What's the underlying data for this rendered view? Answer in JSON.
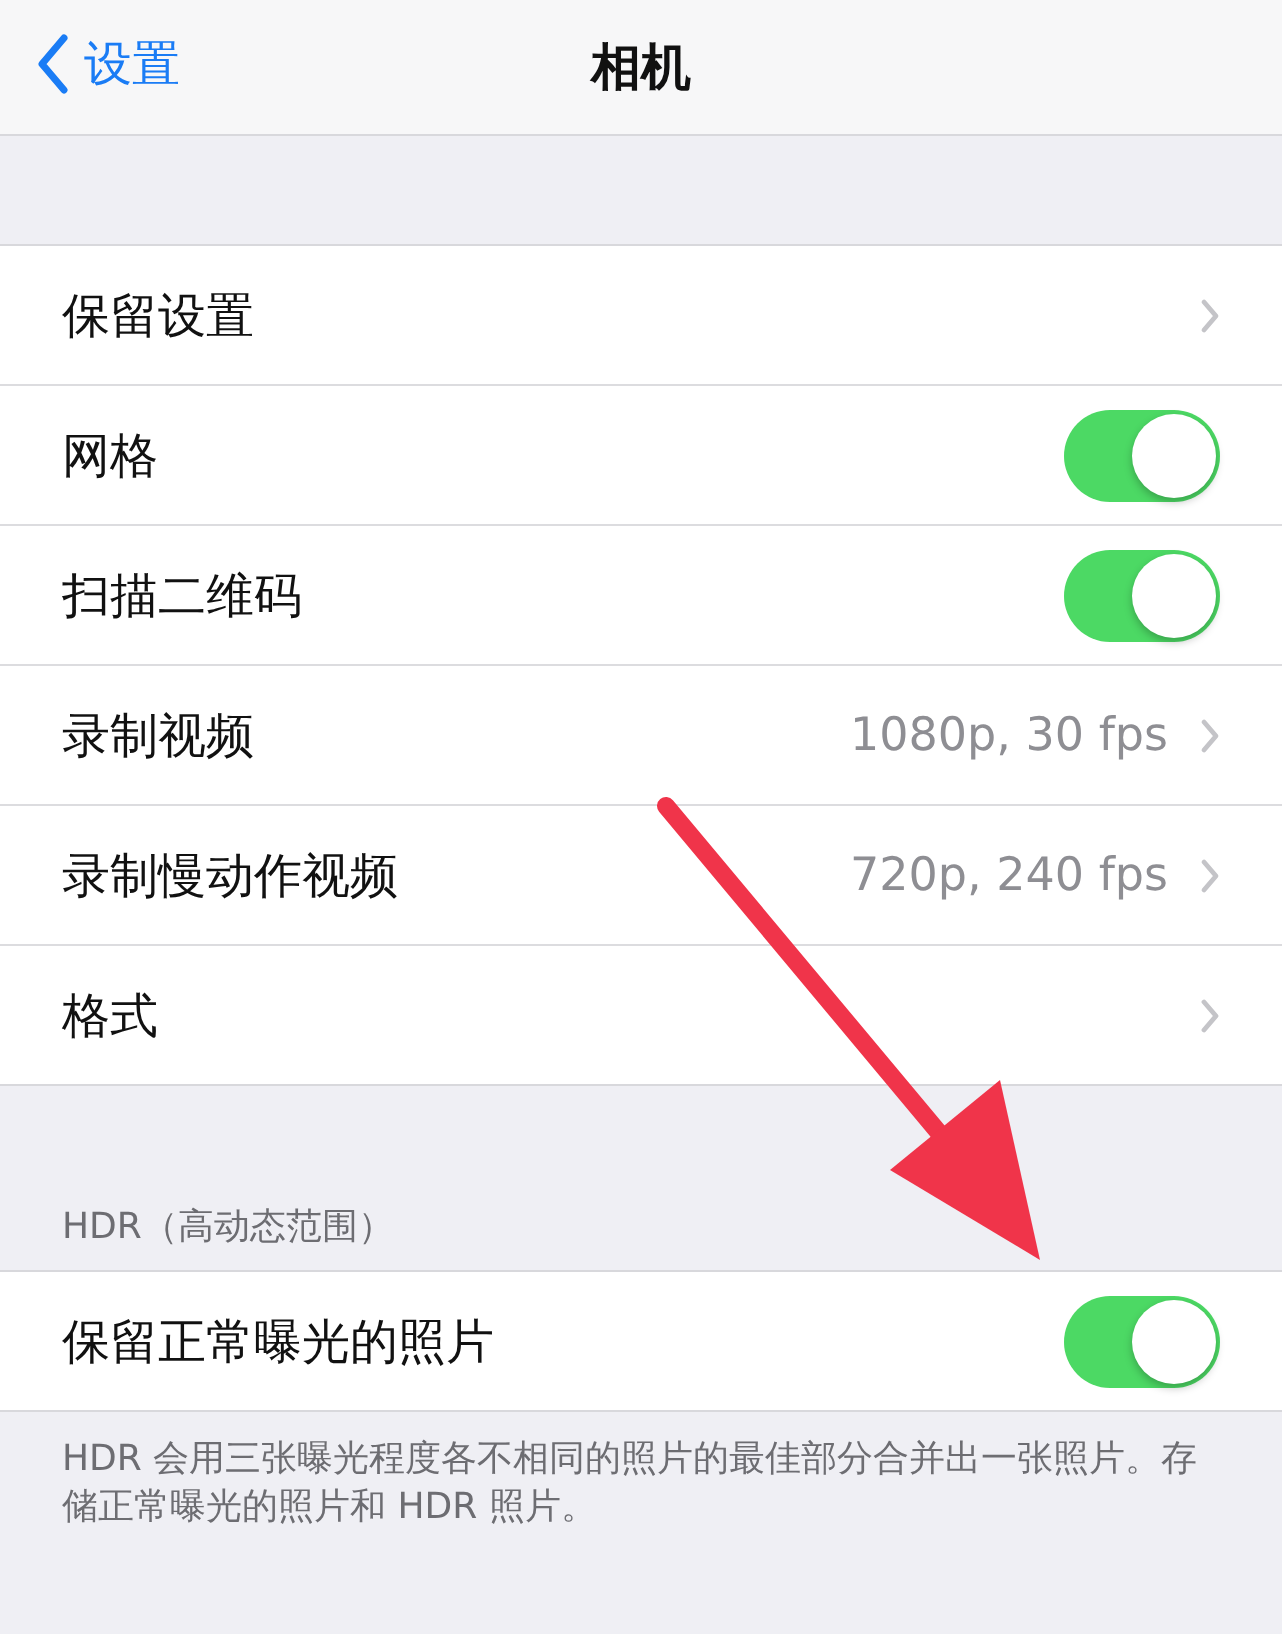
{
  "nav": {
    "back": "设置",
    "title": "相机"
  },
  "sections": [
    {
      "rows": [
        {
          "kind": "link",
          "label": "保留设置"
        },
        {
          "kind": "toggle",
          "label": "网格",
          "on": true
        },
        {
          "kind": "toggle",
          "label": "扫描二维码",
          "on": true
        },
        {
          "kind": "link",
          "label": "录制视频",
          "value": "1080p, 30 fps"
        },
        {
          "kind": "link",
          "label": "录制慢动作视频",
          "value": "720p, 240 fps"
        },
        {
          "kind": "link",
          "label": "格式"
        }
      ]
    },
    {
      "header": "HDR（高动态范围）",
      "rows": [
        {
          "kind": "toggle",
          "label": "保留正常曝光的照片",
          "on": true
        }
      ],
      "footer": "HDR 会用三张曝光程度各不相同的照片的最佳部分合并出一张照片。存储正常曝光的照片和 HDR 照片。"
    }
  ]
}
